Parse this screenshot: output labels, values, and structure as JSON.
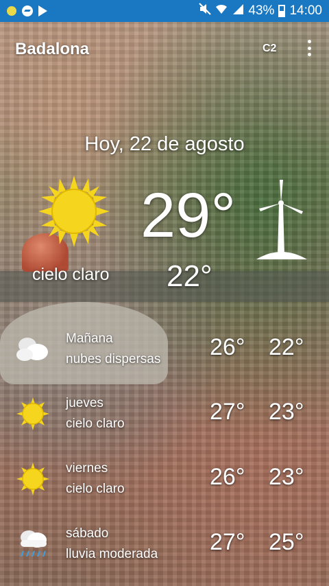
{
  "status_bar": {
    "battery": "43%",
    "time": "14:00",
    "icons": [
      "notification-dot-icon",
      "messenger-icon",
      "play-store-icon",
      "mute-icon",
      "wifi-icon",
      "signal-icon",
      "battery-icon"
    ]
  },
  "header": {
    "city": "Badalona",
    "unit": "C2"
  },
  "current": {
    "date": "Hoy, 22 de agosto",
    "temperature": "29°",
    "low": "22°",
    "condition": "cielo claro",
    "icon": "sun-icon",
    "extra_icon": "wind-turbine-icon"
  },
  "forecast": [
    {
      "day": "Mañana",
      "condition": "nubes dispersas",
      "high": "26°",
      "low": "22°",
      "icon": "cloud-icon"
    },
    {
      "day": "jueves",
      "condition": "cielo claro",
      "high": "27°",
      "low": "23°",
      "icon": "sun-icon"
    },
    {
      "day": "viernes",
      "condition": "cielo claro",
      "high": "26°",
      "low": "23°",
      "icon": "sun-icon"
    },
    {
      "day": "sábado",
      "condition": "lluvia moderada",
      "high": "27°",
      "low": "25°",
      "icon": "rain-cloud-icon"
    }
  ],
  "colors": {
    "status_bar": "#1a78c2",
    "sun": "#f5d51e",
    "text": "#ffffff"
  }
}
